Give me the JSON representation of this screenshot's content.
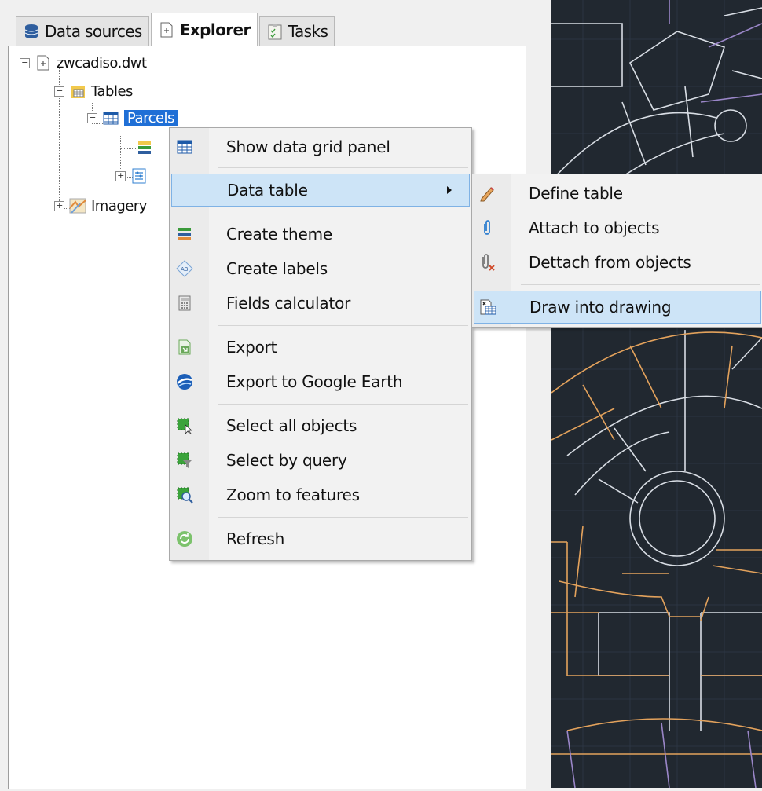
{
  "tabs": [
    {
      "label": "Data sources",
      "icon": "database-icon",
      "active": false
    },
    {
      "label": "Explorer",
      "icon": "explorer-icon",
      "active": true
    },
    {
      "label": "Tasks",
      "icon": "tasks-icon",
      "active": false
    }
  ],
  "tree": {
    "root": "zwcadiso.dwt",
    "tables": "Tables",
    "parcels": "Parcels",
    "imagery": "Imagery"
  },
  "context_menu": {
    "items": [
      {
        "label": "Show data grid panel",
        "icon": "grid-table-icon"
      },
      {
        "label": "Data table",
        "icon": "",
        "submenu": true,
        "highlighted": true
      },
      {
        "label": "Create theme",
        "icon": "theme-icon"
      },
      {
        "label": "Create labels",
        "icon": "label-tag-icon"
      },
      {
        "label": "Fields calculator",
        "icon": "calculator-icon"
      },
      {
        "label": "Export",
        "icon": "export-icon"
      },
      {
        "label": "Export to Google Earth",
        "icon": "google-earth-icon"
      },
      {
        "label": "Select all objects",
        "icon": "select-all-icon"
      },
      {
        "label": "Select by query",
        "icon": "select-query-icon"
      },
      {
        "label": "Zoom to features",
        "icon": "zoom-features-icon"
      },
      {
        "label": "Refresh",
        "icon": "refresh-icon"
      }
    ]
  },
  "submenu": {
    "items": [
      {
        "label": "Define table",
        "icon": "pencil-icon"
      },
      {
        "label": "Attach to objects",
        "icon": "paperclip-icon"
      },
      {
        "label": "Dettach from objects",
        "icon": "paperclip-remove-icon"
      },
      {
        "label": "Draw into drawing",
        "icon": "draw-table-icon",
        "highlighted": true
      }
    ]
  },
  "colors": {
    "selection": "#1f6fd6",
    "menu_highlight": "#cde4f7",
    "drawing_background": "#212830",
    "drawing_line_white": "#d8dde4",
    "drawing_line_orange": "#e3a25c",
    "drawing_line_purple": "#9a86c8"
  }
}
